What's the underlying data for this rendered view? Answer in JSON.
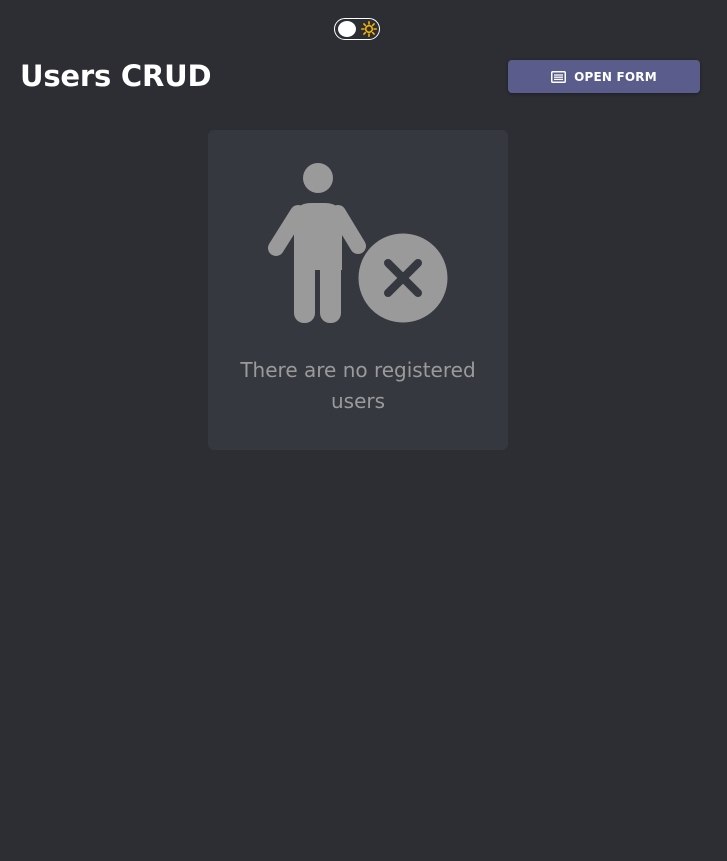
{
  "header": {
    "title": "Users CRUD",
    "open_form_label": "OPEN FORM",
    "open_form_icon": "list-icon"
  },
  "theme_toggle": {
    "state": "dark",
    "icon": "sun-icon",
    "icon_color": "#f5b400"
  },
  "empty_state": {
    "icon": "user-remove-icon",
    "message": "There are no registered users"
  },
  "colors": {
    "background": "#2c2e33",
    "card": "#363840",
    "accent": "#5a5c8c",
    "muted_text": "#9a9a9a"
  }
}
